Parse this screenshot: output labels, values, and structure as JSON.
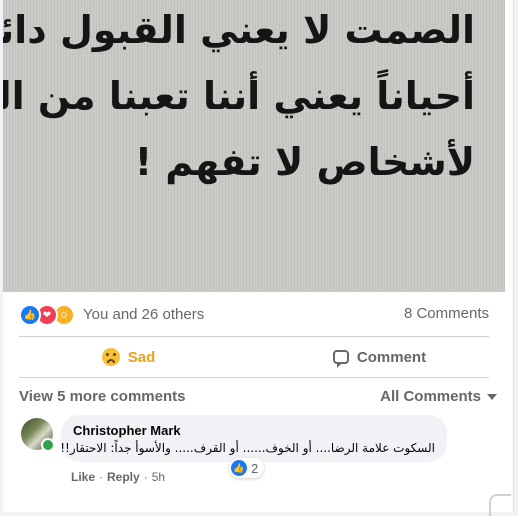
{
  "post": {
    "image_quote_lines": [
      "الصمت لا يعني القبول دائماً",
      "أحياناً يعني أننا تعبنا من التفسير",
      "لأشخاص لا تفهم !"
    ]
  },
  "reactions": {
    "summary": "You and 26 others",
    "comments_count": "8 Comments",
    "icons": [
      "like-icon",
      "love-icon",
      "care-icon"
    ]
  },
  "actions": {
    "reaction_label": "Sad",
    "comment_label": "Comment"
  },
  "comments_section": {
    "view_more": "View 5 more comments",
    "filter_label": "All Comments"
  },
  "comment": {
    "author": "Christopher Mark",
    "text": "السكوت علامة الرضا.... أو الخوف...... أو القرف..... والأسوأ جداً: الاحتقار!!",
    "reaction_count": "2",
    "like_label": "Like",
    "reply_label": "Reply",
    "separator": "·",
    "time": "5h"
  },
  "colors": {
    "accent": "#1877f2",
    "sad": "#e9a21e",
    "muted": "#65676b"
  }
}
